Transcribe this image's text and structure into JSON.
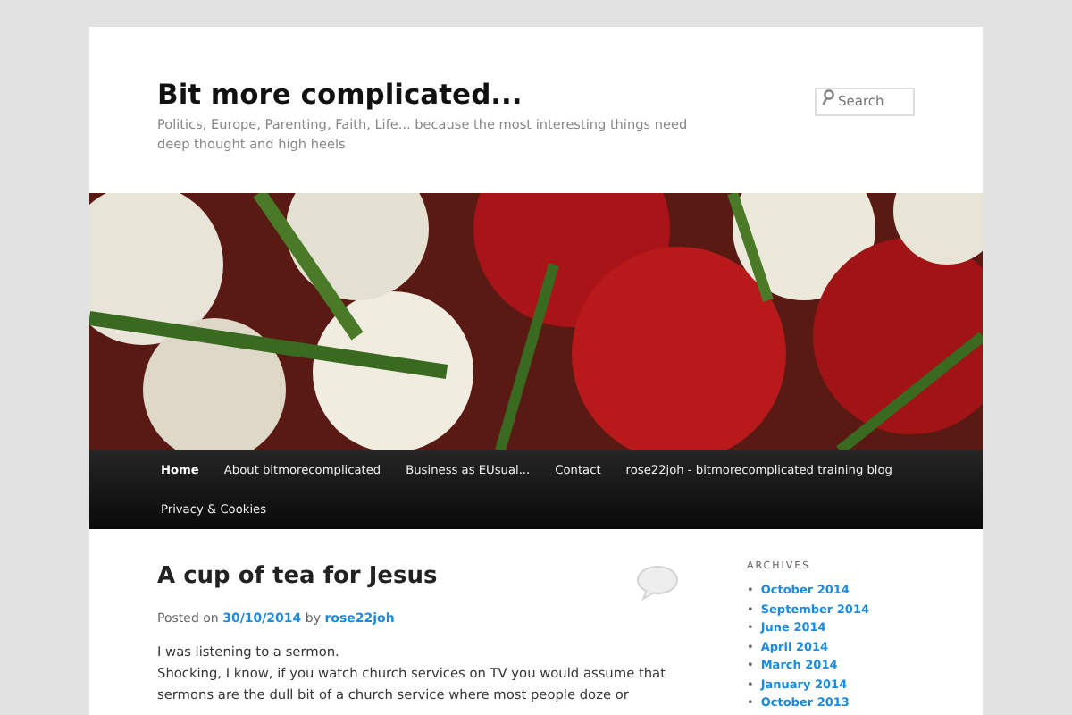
{
  "site": {
    "title": "Bit more complicated...",
    "tagline": "Politics, Europe, Parenting, Faith, Life... because the most interesting things need deep thought and high heels"
  },
  "search": {
    "placeholder": "Search"
  },
  "nav": [
    {
      "label": "Home",
      "selected": true
    },
    {
      "label": "About bitmorecomplicated",
      "selected": false
    },
    {
      "label": "Business as EUsual...",
      "selected": false
    },
    {
      "label": "Contact",
      "selected": false
    },
    {
      "label": "rose22joh - bitmorecomplicated training blog",
      "selected": false
    },
    {
      "label": "Privacy & Cookies",
      "selected": false
    }
  ],
  "post": {
    "title": "A cup of tea for Jesus",
    "posted_on": "Posted on",
    "date": "30/10/2014",
    "by": "by",
    "author": "rose22joh",
    "paragraphs": [
      "I was listening to a sermon.",
      "Shocking, I know, if you watch church services on TV you would assume that sermons are the dull bit of a church service where most people doze or"
    ]
  },
  "sidebar": {
    "heading": "ARCHIVES",
    "items": [
      {
        "bullet": "•",
        "label": "October 2014"
      },
      {
        "bullet": "•",
        "label": "September 2014"
      },
      {
        "bullet": "•",
        "label": "June 2014"
      },
      {
        "bullet": "•",
        "label": "April 2014"
      },
      {
        "bullet": "•",
        "label": "March 2014"
      },
      {
        "bullet": "•",
        "label": "January 2014"
      },
      {
        "bullet": "•",
        "label": "October 2013"
      }
    ]
  }
}
